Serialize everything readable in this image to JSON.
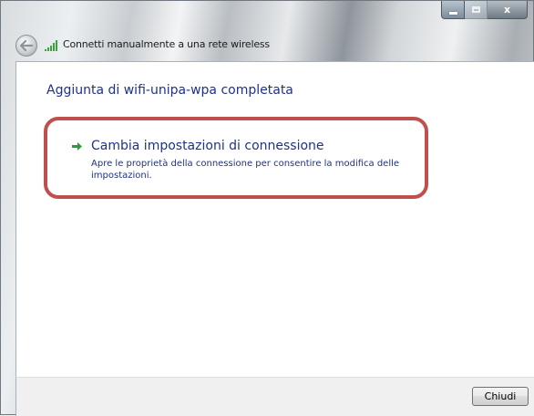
{
  "window": {
    "title": "Connetti manualmente a una rete wireless",
    "controls": {
      "minimize_icon": "minimize-icon",
      "maximize_icon": "maximize-icon",
      "close_glyph": "x"
    }
  },
  "navigation": {
    "back_icon": "back-arrow-icon",
    "network_icon": "wireless-signal-icon"
  },
  "content": {
    "heading": "Aggiunta di wifi-unipa-wpa completata",
    "action": {
      "icon": "green-arrow-icon",
      "title": "Cambia impostazioni di connessione",
      "description": "Apre le proprietà della connessione per consentire la modifica delle impostazioni."
    },
    "highlight_color": "#c0504d"
  },
  "footer": {
    "close_button": "Chiudi"
  },
  "colors": {
    "link_text": "#1e3287",
    "arrow": "#2e9b3a"
  }
}
